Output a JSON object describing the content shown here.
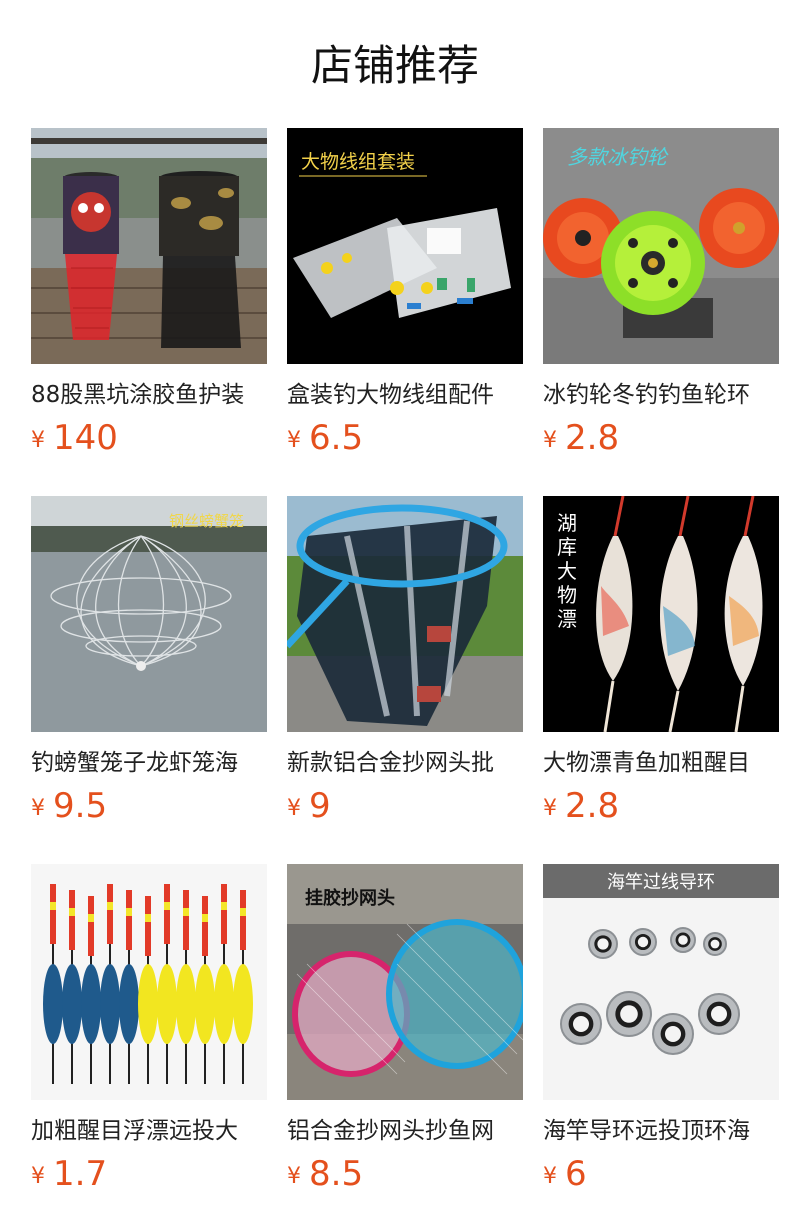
{
  "page_title": "店铺推荐",
  "currency_symbol": "¥",
  "products": [
    {
      "name": "88股黑坑涂胶鱼护装",
      "price": "140",
      "image_caption": ""
    },
    {
      "name": "盒装钓大物线组配件",
      "price": "6.5",
      "image_caption": "大物线组套装"
    },
    {
      "name": "冰钓轮冬钓钓鱼轮环",
      "price": "2.8",
      "image_caption": "多款冰钓轮"
    },
    {
      "name": "钓螃蟹笼子龙虾笼海",
      "price": "9.5",
      "image_caption": "钢丝螃蟹笼"
    },
    {
      "name": "新款铝合金抄网头批",
      "price": "9",
      "image_caption": ""
    },
    {
      "name": "大物漂青鱼加粗醒目",
      "price": "2.8",
      "image_caption": "湖库大物漂"
    },
    {
      "name": "加粗醒目浮漂远投大",
      "price": "1.7",
      "image_caption": ""
    },
    {
      "name": "铝合金抄网头抄鱼网",
      "price": "8.5",
      "image_caption": "挂胶抄网头"
    },
    {
      "name": "海竿导环远投顶环海",
      "price": "6",
      "image_caption": "海竿过线导环"
    }
  ]
}
